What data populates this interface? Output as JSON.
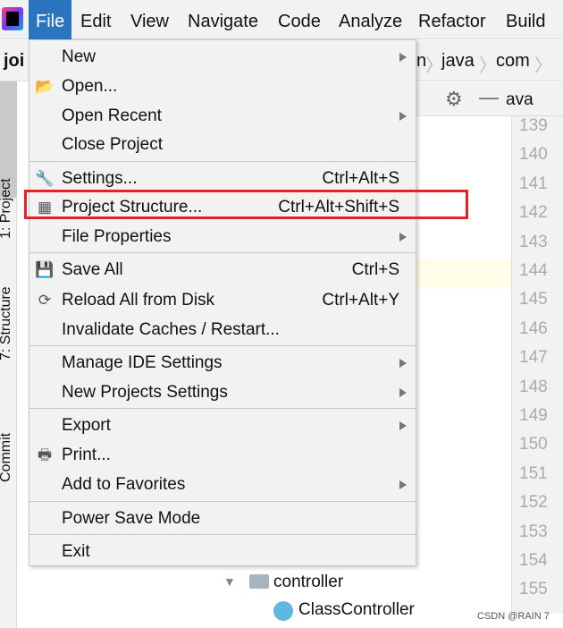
{
  "menubar": {
    "items": [
      "File",
      "Edit",
      "View",
      "Navigate",
      "Code",
      "Analyze",
      "Refactor",
      "Build"
    ],
    "active": "File"
  },
  "navbar": {
    "project": "joi",
    "breadcrumbs": [
      "n",
      "java",
      "com"
    ],
    "tab": "ava"
  },
  "leftbar": {
    "tabs": [
      "1: Project",
      "7: Structure",
      "Commit"
    ]
  },
  "line_numbers": [
    "139",
    "140",
    "141",
    "142",
    "143",
    "144",
    "145",
    "146",
    "147",
    "148",
    "149",
    "150",
    "151",
    "152",
    "153",
    "154",
    "155"
  ],
  "tree": {
    "folder": "controller",
    "class": "ClassController"
  },
  "menu": {
    "items": [
      {
        "label": "New",
        "submenu": true
      },
      {
        "label": "Open...",
        "icon": "folder-open-icon"
      },
      {
        "label": "Open Recent",
        "submenu": true
      },
      {
        "label": "Close Project"
      },
      {
        "label": "Settings...",
        "shortcut": "Ctrl+Alt+S",
        "icon": "wrench-icon"
      },
      {
        "label": "Project Structure...",
        "shortcut": "Ctrl+Alt+Shift+S",
        "icon": "project-structure-icon"
      },
      {
        "label": "File Properties",
        "submenu": true
      },
      {
        "label": "Save All",
        "shortcut": "Ctrl+S",
        "icon": "save-icon"
      },
      {
        "label": "Reload All from Disk",
        "shortcut": "Ctrl+Alt+Y",
        "icon": "reload-icon"
      },
      {
        "label": "Invalidate Caches / Restart..."
      },
      {
        "label": "Manage IDE Settings",
        "submenu": true
      },
      {
        "label": "New Projects Settings",
        "submenu": true
      },
      {
        "label": "Export",
        "submenu": true
      },
      {
        "label": "Print...",
        "icon": "printer-icon"
      },
      {
        "label": "Add to Favorites",
        "submenu": true
      },
      {
        "label": "Power Save Mode"
      },
      {
        "label": "Exit"
      }
    ]
  },
  "highlight_color": "#e5222a",
  "watermark": "CSDN @RAIN 7"
}
